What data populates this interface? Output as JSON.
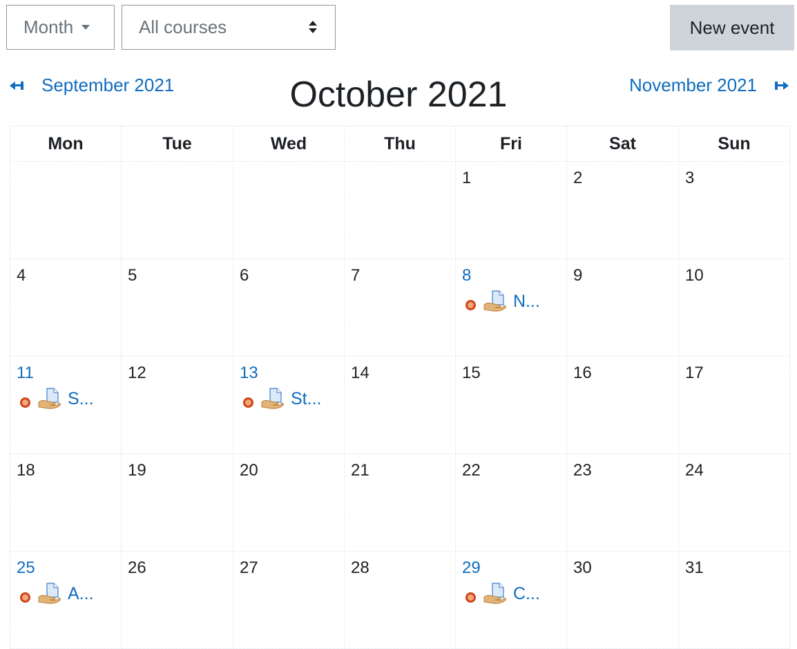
{
  "toolbar": {
    "view_select": "Month",
    "course_select": "All courses",
    "new_event": "New event"
  },
  "nav": {
    "prev": "September 2021",
    "next": "November 2021",
    "title": "October 2021"
  },
  "weekdays": [
    "Mon",
    "Tue",
    "Wed",
    "Thu",
    "Fri",
    "Sat",
    "Sun"
  ],
  "weeks": [
    [
      {
        "day": ""
      },
      {
        "day": ""
      },
      {
        "day": ""
      },
      {
        "day": ""
      },
      {
        "day": "1"
      },
      {
        "day": "2"
      },
      {
        "day": "3"
      }
    ],
    [
      {
        "day": "4"
      },
      {
        "day": "5"
      },
      {
        "day": "6"
      },
      {
        "day": "7"
      },
      {
        "day": "8",
        "event": "N..."
      },
      {
        "day": "9"
      },
      {
        "day": "10"
      }
    ],
    [
      {
        "day": "11",
        "event": "S..."
      },
      {
        "day": "12"
      },
      {
        "day": "13",
        "event": "St..."
      },
      {
        "day": "14"
      },
      {
        "day": "15"
      },
      {
        "day": "16"
      },
      {
        "day": "17"
      }
    ],
    [
      {
        "day": "18"
      },
      {
        "day": "19"
      },
      {
        "day": "20"
      },
      {
        "day": "21"
      },
      {
        "day": "22"
      },
      {
        "day": "23"
      },
      {
        "day": "24"
      }
    ],
    [
      {
        "day": "25",
        "event": "A..."
      },
      {
        "day": "26"
      },
      {
        "day": "27"
      },
      {
        "day": "28"
      },
      {
        "day": "29",
        "event": "C..."
      },
      {
        "day": "30"
      },
      {
        "day": "31"
      }
    ]
  ],
  "colors": {
    "link": "#0f6cbf",
    "button_bg": "#ced4da",
    "event_dot": "#d0441a"
  },
  "icons": {
    "event_marker": "circle-dot-icon",
    "event_type": "assignment-hand-icon"
  }
}
